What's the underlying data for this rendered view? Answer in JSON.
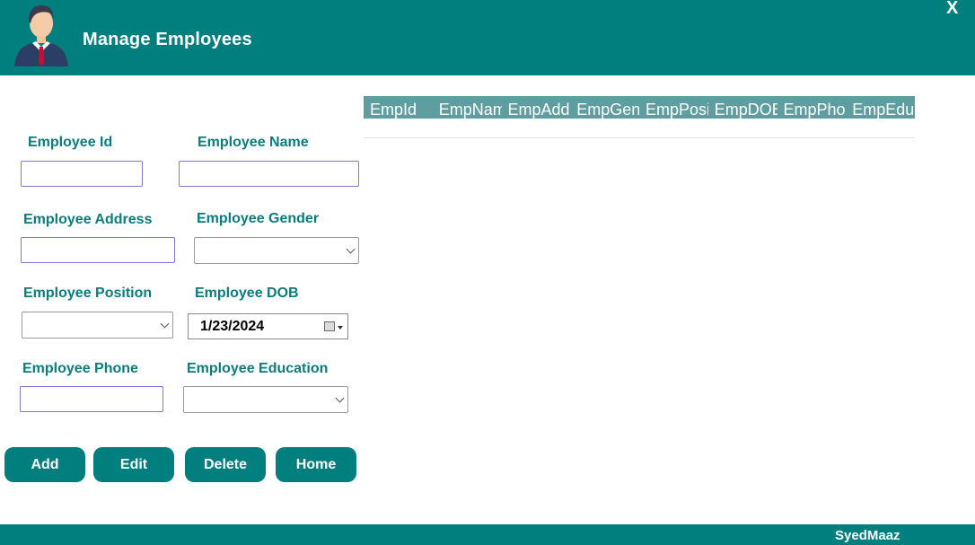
{
  "header": {
    "title": "Manage Employees",
    "close_label": "X"
  },
  "form": {
    "employee_id": {
      "label": "Employee Id",
      "value": ""
    },
    "employee_name": {
      "label": "Employee Name",
      "value": ""
    },
    "employee_address": {
      "label": "Employee Address",
      "value": ""
    },
    "employee_gender": {
      "label": "Employee Gender",
      "selected": ""
    },
    "employee_position": {
      "label": "Employee Position",
      "selected": ""
    },
    "employee_dob": {
      "label": "Employee DOB",
      "value": "1/23/2024"
    },
    "employee_phone": {
      "label": "Employee Phone",
      "value": ""
    },
    "employee_education": {
      "label": "Employee Education",
      "selected": ""
    }
  },
  "grid": {
    "columns": [
      "EmpId",
      "EmpName",
      "EmpAddress",
      "EmpGender",
      "EmpPosition",
      "EmpDOB",
      "EmpPhone",
      "EmpEducation"
    ]
  },
  "buttons": {
    "add": "Add",
    "edit": "Edit",
    "delete": "Delete",
    "home": "Home"
  },
  "footer": {
    "text": "SyedMaaz"
  },
  "colors": {
    "accent": "#017f7f",
    "grid_header": "#5f9ea0",
    "label_text": "#0b7c7c"
  }
}
